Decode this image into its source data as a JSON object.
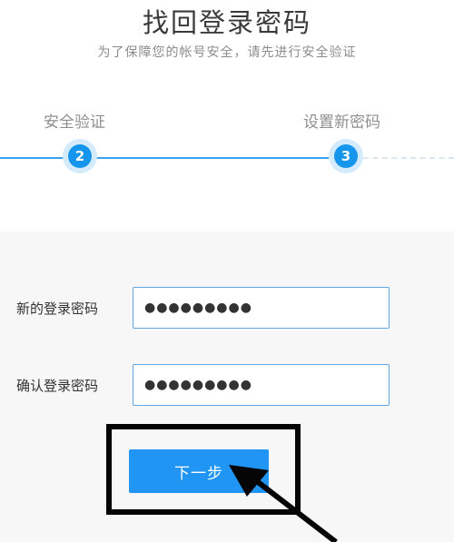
{
  "header": {
    "title": "找回登录密码",
    "subtitle": "为了保障您的帐号安全，请先进行安全验证"
  },
  "steps": [
    {
      "label": "安全验证",
      "number": "2"
    },
    {
      "label": "设置新密码",
      "number": "3"
    }
  ],
  "form": {
    "new_password": {
      "label": "新的登录密码",
      "value": "●●●●●●●●●"
    },
    "confirm_password": {
      "label": "确认登录密码",
      "value": "●●●●●●●●●"
    },
    "next_button_label": "下一步"
  },
  "colors": {
    "accent": "#2195f3",
    "step_active": "#1596ec",
    "annotation": "#050505"
  },
  "annotation": {
    "icon": "pointer-arrow-icon"
  }
}
